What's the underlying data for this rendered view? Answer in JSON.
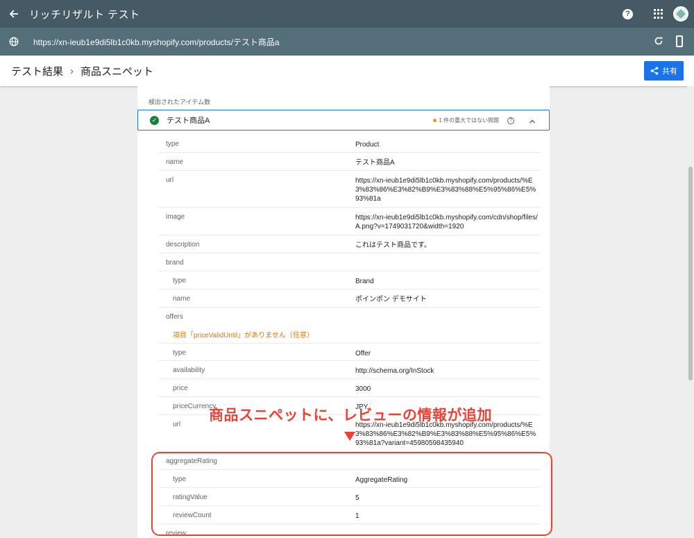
{
  "appbar": {
    "title": "リッチリザルト テスト",
    "help": "?"
  },
  "urlbar": {
    "url": "https://xn-ieub1e9di5lb1c0kb.myshopify.com/products/テスト商品a"
  },
  "breadcrumb": {
    "root": "テスト結果",
    "separator": "›",
    "current": "商品スニペット"
  },
  "share": {
    "label": "共有"
  },
  "panel": {
    "detected_label": "検出されたアイテム数",
    "item_name": "テスト商品A",
    "issue_text": "1 件の重大ではない問題",
    "issue_help": "?"
  },
  "rows": [
    {
      "key": "type",
      "value": "Product"
    },
    {
      "key": "name",
      "value": "テスト商品A"
    },
    {
      "key": "url",
      "value": "https://xn-ieub1e9di5lb1c0kb.myshopify.com/products/%E3%83%86%E3%82%B9%E3%83%88%E5%95%86%E5%93%81a"
    },
    {
      "key": "image",
      "value": "https://xn-ieub1e9di5lb1c0kb.myshopify.com/cdn/shop/files/A.png?v=1749031720&width=1920"
    },
    {
      "key": "description",
      "value": "これはテスト商品です。"
    },
    {
      "key": "brand",
      "value": ""
    },
    {
      "key": "type",
      "value": "Brand"
    },
    {
      "key": "name",
      "value": "ポインポン デモサイト"
    },
    {
      "key": "offers",
      "value": ""
    },
    {
      "key": "warning",
      "value": "項目「priceValidUntil」がありません（任意）"
    },
    {
      "key": "type",
      "value": "Offer"
    },
    {
      "key": "availability",
      "value": "http://schema.org/InStock"
    },
    {
      "key": "price",
      "value": "3000"
    },
    {
      "key": "priceCurrency",
      "value": "JPY"
    },
    {
      "key": "url",
      "value": "https://xn-ieub1e9di5lb1c0kb.myshopify.com/products/%E3%83%86%E3%82%B9%E3%83%88%E5%95%86%E5%93%81a?variant=45980598435940"
    },
    {
      "key": "aggregateRating",
      "value": ""
    },
    {
      "key": "type",
      "value": "AggregateRating"
    },
    {
      "key": "ratingValue",
      "value": "5"
    },
    {
      "key": "reviewCount",
      "value": "1"
    },
    {
      "key": "review",
      "value": ""
    }
  ],
  "annotation": {
    "text": "商品スニペットに、レビューの情報が追加",
    "color": "#ea4335"
  },
  "colors": {
    "appbar": "#455a64",
    "urlbar": "#546e7a",
    "accent": "#1a73e8",
    "valid": "#188038",
    "warning": "#e37400"
  }
}
